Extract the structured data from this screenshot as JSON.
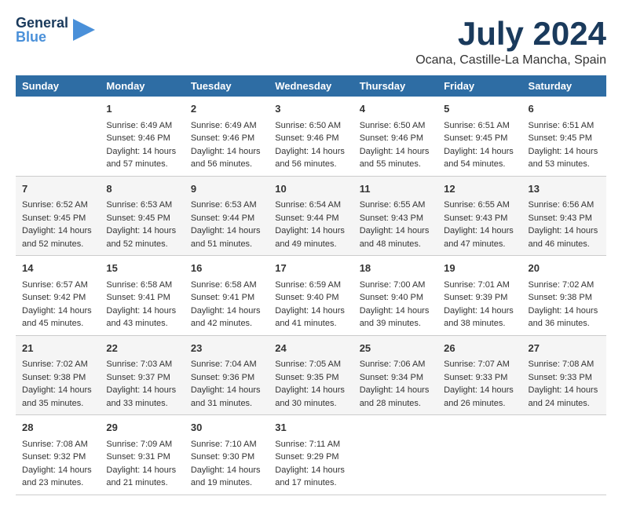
{
  "logo": {
    "general": "General",
    "blue": "Blue"
  },
  "title": {
    "month_year": "July 2024",
    "location": "Ocana, Castille-La Mancha, Spain"
  },
  "days_of_week": [
    "Sunday",
    "Monday",
    "Tuesday",
    "Wednesday",
    "Thursday",
    "Friday",
    "Saturday"
  ],
  "weeks": [
    [
      {
        "day": "",
        "sunrise": "",
        "sunset": "",
        "daylight": ""
      },
      {
        "day": "1",
        "sunrise": "Sunrise: 6:49 AM",
        "sunset": "Sunset: 9:46 PM",
        "daylight": "Daylight: 14 hours and 57 minutes."
      },
      {
        "day": "2",
        "sunrise": "Sunrise: 6:49 AM",
        "sunset": "Sunset: 9:46 PM",
        "daylight": "Daylight: 14 hours and 56 minutes."
      },
      {
        "day": "3",
        "sunrise": "Sunrise: 6:50 AM",
        "sunset": "Sunset: 9:46 PM",
        "daylight": "Daylight: 14 hours and 56 minutes."
      },
      {
        "day": "4",
        "sunrise": "Sunrise: 6:50 AM",
        "sunset": "Sunset: 9:46 PM",
        "daylight": "Daylight: 14 hours and 55 minutes."
      },
      {
        "day": "5",
        "sunrise": "Sunrise: 6:51 AM",
        "sunset": "Sunset: 9:45 PM",
        "daylight": "Daylight: 14 hours and 54 minutes."
      },
      {
        "day": "6",
        "sunrise": "Sunrise: 6:51 AM",
        "sunset": "Sunset: 9:45 PM",
        "daylight": "Daylight: 14 hours and 53 minutes."
      }
    ],
    [
      {
        "day": "7",
        "sunrise": "Sunrise: 6:52 AM",
        "sunset": "Sunset: 9:45 PM",
        "daylight": "Daylight: 14 hours and 52 minutes."
      },
      {
        "day": "8",
        "sunrise": "Sunrise: 6:53 AM",
        "sunset": "Sunset: 9:45 PM",
        "daylight": "Daylight: 14 hours and 52 minutes."
      },
      {
        "day": "9",
        "sunrise": "Sunrise: 6:53 AM",
        "sunset": "Sunset: 9:44 PM",
        "daylight": "Daylight: 14 hours and 51 minutes."
      },
      {
        "day": "10",
        "sunrise": "Sunrise: 6:54 AM",
        "sunset": "Sunset: 9:44 PM",
        "daylight": "Daylight: 14 hours and 49 minutes."
      },
      {
        "day": "11",
        "sunrise": "Sunrise: 6:55 AM",
        "sunset": "Sunset: 9:43 PM",
        "daylight": "Daylight: 14 hours and 48 minutes."
      },
      {
        "day": "12",
        "sunrise": "Sunrise: 6:55 AM",
        "sunset": "Sunset: 9:43 PM",
        "daylight": "Daylight: 14 hours and 47 minutes."
      },
      {
        "day": "13",
        "sunrise": "Sunrise: 6:56 AM",
        "sunset": "Sunset: 9:43 PM",
        "daylight": "Daylight: 14 hours and 46 minutes."
      }
    ],
    [
      {
        "day": "14",
        "sunrise": "Sunrise: 6:57 AM",
        "sunset": "Sunset: 9:42 PM",
        "daylight": "Daylight: 14 hours and 45 minutes."
      },
      {
        "day": "15",
        "sunrise": "Sunrise: 6:58 AM",
        "sunset": "Sunset: 9:41 PM",
        "daylight": "Daylight: 14 hours and 43 minutes."
      },
      {
        "day": "16",
        "sunrise": "Sunrise: 6:58 AM",
        "sunset": "Sunset: 9:41 PM",
        "daylight": "Daylight: 14 hours and 42 minutes."
      },
      {
        "day": "17",
        "sunrise": "Sunrise: 6:59 AM",
        "sunset": "Sunset: 9:40 PM",
        "daylight": "Daylight: 14 hours and 41 minutes."
      },
      {
        "day": "18",
        "sunrise": "Sunrise: 7:00 AM",
        "sunset": "Sunset: 9:40 PM",
        "daylight": "Daylight: 14 hours and 39 minutes."
      },
      {
        "day": "19",
        "sunrise": "Sunrise: 7:01 AM",
        "sunset": "Sunset: 9:39 PM",
        "daylight": "Daylight: 14 hours and 38 minutes."
      },
      {
        "day": "20",
        "sunrise": "Sunrise: 7:02 AM",
        "sunset": "Sunset: 9:38 PM",
        "daylight": "Daylight: 14 hours and 36 minutes."
      }
    ],
    [
      {
        "day": "21",
        "sunrise": "Sunrise: 7:02 AM",
        "sunset": "Sunset: 9:38 PM",
        "daylight": "Daylight: 14 hours and 35 minutes."
      },
      {
        "day": "22",
        "sunrise": "Sunrise: 7:03 AM",
        "sunset": "Sunset: 9:37 PM",
        "daylight": "Daylight: 14 hours and 33 minutes."
      },
      {
        "day": "23",
        "sunrise": "Sunrise: 7:04 AM",
        "sunset": "Sunset: 9:36 PM",
        "daylight": "Daylight: 14 hours and 31 minutes."
      },
      {
        "day": "24",
        "sunrise": "Sunrise: 7:05 AM",
        "sunset": "Sunset: 9:35 PM",
        "daylight": "Daylight: 14 hours and 30 minutes."
      },
      {
        "day": "25",
        "sunrise": "Sunrise: 7:06 AM",
        "sunset": "Sunset: 9:34 PM",
        "daylight": "Daylight: 14 hours and 28 minutes."
      },
      {
        "day": "26",
        "sunrise": "Sunrise: 7:07 AM",
        "sunset": "Sunset: 9:33 PM",
        "daylight": "Daylight: 14 hours and 26 minutes."
      },
      {
        "day": "27",
        "sunrise": "Sunrise: 7:08 AM",
        "sunset": "Sunset: 9:33 PM",
        "daylight": "Daylight: 14 hours and 24 minutes."
      }
    ],
    [
      {
        "day": "28",
        "sunrise": "Sunrise: 7:08 AM",
        "sunset": "Sunset: 9:32 PM",
        "daylight": "Daylight: 14 hours and 23 minutes."
      },
      {
        "day": "29",
        "sunrise": "Sunrise: 7:09 AM",
        "sunset": "Sunset: 9:31 PM",
        "daylight": "Daylight: 14 hours and 21 minutes."
      },
      {
        "day": "30",
        "sunrise": "Sunrise: 7:10 AM",
        "sunset": "Sunset: 9:30 PM",
        "daylight": "Daylight: 14 hours and 19 minutes."
      },
      {
        "day": "31",
        "sunrise": "Sunrise: 7:11 AM",
        "sunset": "Sunset: 9:29 PM",
        "daylight": "Daylight: 14 hours and 17 minutes."
      },
      {
        "day": "",
        "sunrise": "",
        "sunset": "",
        "daylight": ""
      },
      {
        "day": "",
        "sunrise": "",
        "sunset": "",
        "daylight": ""
      },
      {
        "day": "",
        "sunrise": "",
        "sunset": "",
        "daylight": ""
      }
    ]
  ]
}
